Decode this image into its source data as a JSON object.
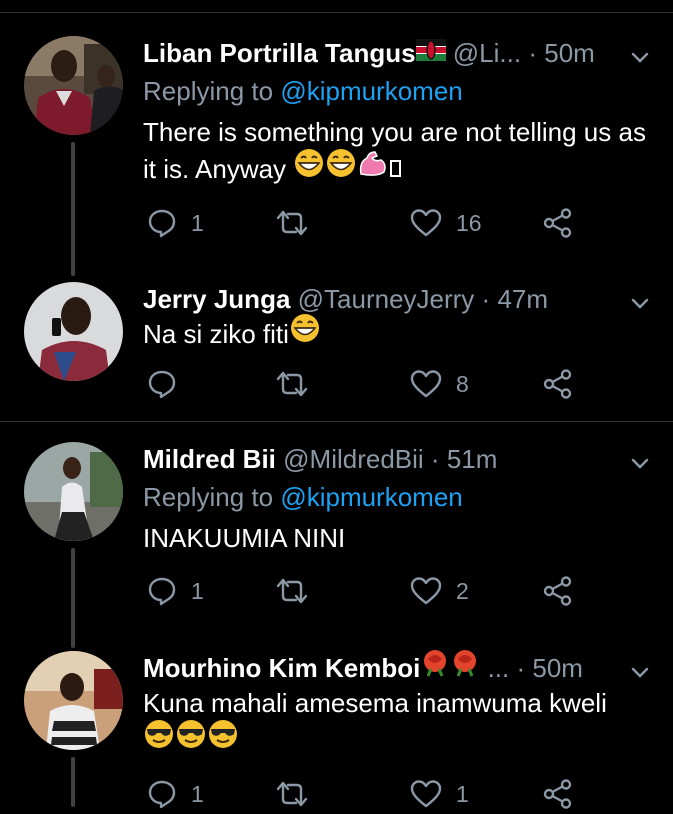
{
  "tweets": [
    {
      "name": "Liban Portrilla Tangus",
      "handle": "@Li...",
      "dot": "·",
      "time": "50m",
      "replying_prefix": "Replying to",
      "replying_to": "@kipmurkomen",
      "text": "There is something you are not telling us as it is. Anyway",
      "reply_count": "1",
      "retweet_count": "",
      "like_count": "16"
    },
    {
      "name": "Jerry Junga",
      "handle": "@TaurneyJerry",
      "dot": "·",
      "time": "47m",
      "text": "Na si ziko fiti",
      "reply_count": "",
      "retweet_count": "",
      "like_count": "8"
    },
    {
      "name": "Mildred Bii",
      "handle": "@MildredBii",
      "dot": "·",
      "time": "51m",
      "replying_prefix": "Replying to",
      "replying_to": "@kipmurkomen",
      "text": "INAKUUMIA NINI",
      "reply_count": "1",
      "retweet_count": "",
      "like_count": "2"
    },
    {
      "name": "Mourhino Kim Kemboi",
      "handle": "...",
      "dot": "·",
      "time": "50m",
      "text": "Kuna mahali amesema inamwuma kweli",
      "reply_count": "1",
      "retweet_count": "",
      "like_count": "1"
    }
  ],
  "icons": {
    "reply": "reply-icon",
    "retweet": "retweet-icon",
    "like": "heart-icon",
    "share": "share-icon",
    "more": "chevron-down-icon"
  },
  "colors": {
    "background": "#000000",
    "secondary": "#8b98a5",
    "link": "#1da1f2",
    "thread": "#3d4245"
  }
}
